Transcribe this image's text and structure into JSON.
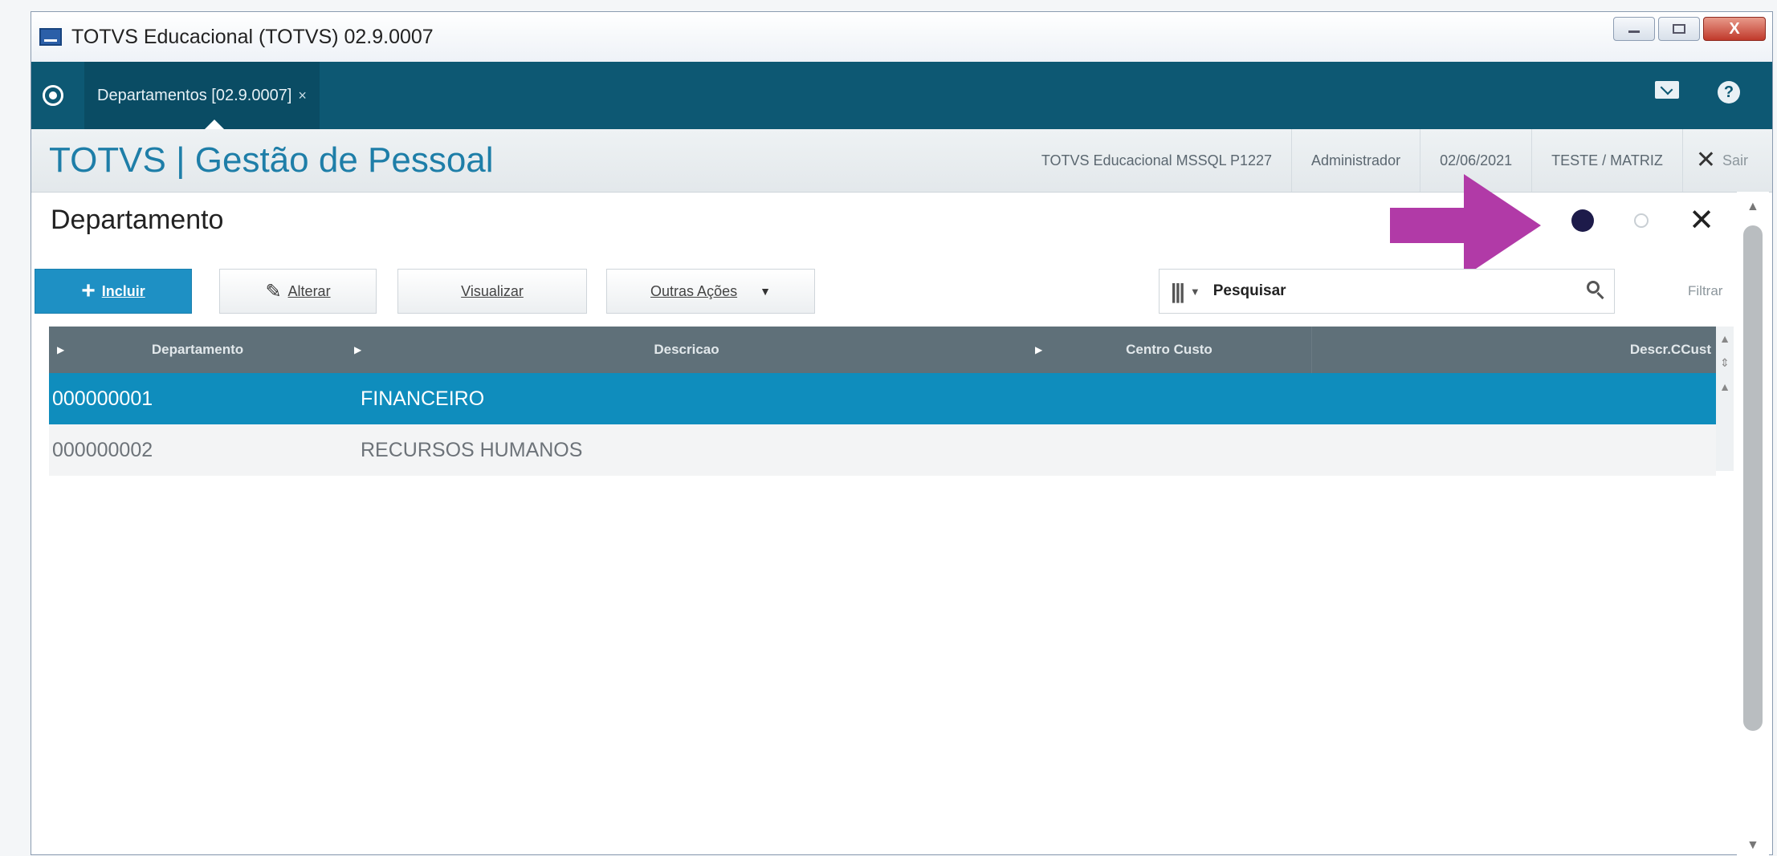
{
  "window": {
    "title": "TOTVS Educacional (TOTVS) 02.9.0007",
    "close_glyph": "X"
  },
  "tabbar": {
    "active_tab": "Departamentos [02.9.0007]",
    "tab_close": "×",
    "help_glyph": "?"
  },
  "header": {
    "brand": "TOTVS | Gestão de Pessoal",
    "environment": "TOTVS Educacional MSSQL P1227",
    "user": "Administrador",
    "date": "02/06/2021",
    "branch": "TESTE / MATRIZ",
    "exit_label": "Sair",
    "exit_glyph": "✕"
  },
  "panel": {
    "title": "Departamento",
    "close_glyph": "✕"
  },
  "toolbar": {
    "incluir_label": "Incluir",
    "alterar_label": "Alterar",
    "visualizar_label": "Visualizar",
    "outras_acoes_label": "Outras Ações",
    "search_placeholder": "Pesquisar",
    "filter_label": "Filtrar"
  },
  "grid": {
    "columns": [
      "Departamento",
      "Descricao",
      "Centro Custo",
      "Descr.CCust"
    ],
    "rows": [
      {
        "departamento": "000000001",
        "descricao": "FINANCEIRO",
        "selected": true
      },
      {
        "departamento": "000000002",
        "descricao": "RECURSOS HUMANOS",
        "selected": false
      }
    ]
  },
  "colors": {
    "tabbar": "#0d5873",
    "brand_text": "#1e7ea8",
    "primary_button": "#1e90c4",
    "selected_row": "#0f8dbd",
    "grid_header": "#5f7079",
    "annotation_arrow": "#b13aa7"
  }
}
